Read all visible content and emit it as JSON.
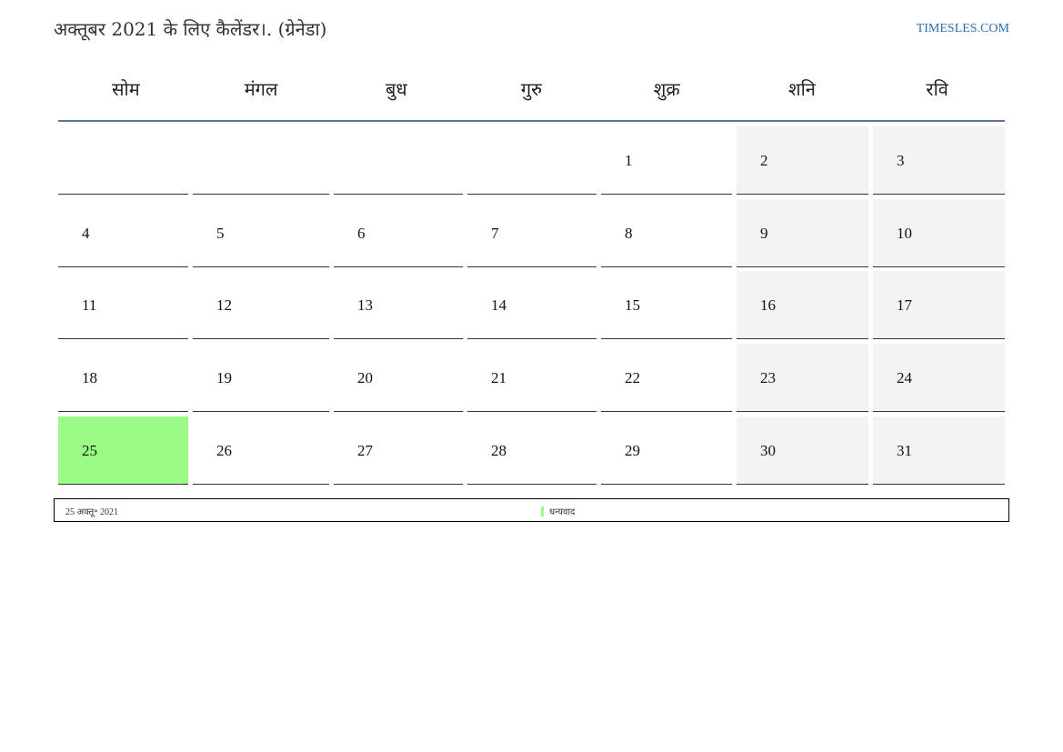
{
  "header": {
    "title": "अक्तूबर 2021 के लिए कैलेंडर।. (ग्रेनेडा)",
    "site": "TIMESLES.COM"
  },
  "weekdays": [
    "सोम",
    "मंगल",
    "बुध",
    "गुरु",
    "शुक्र",
    "शनि",
    "रवि"
  ],
  "weeks": [
    [
      "",
      "",
      "",
      "",
      "1",
      "2",
      "3"
    ],
    [
      "4",
      "5",
      "6",
      "7",
      "8",
      "9",
      "10"
    ],
    [
      "11",
      "12",
      "13",
      "14",
      "15",
      "16",
      "17"
    ],
    [
      "18",
      "19",
      "20",
      "21",
      "22",
      "23",
      "24"
    ],
    [
      "25",
      "26",
      "27",
      "28",
      "29",
      "30",
      "31"
    ]
  ],
  "highlight_day": "25",
  "colors": {
    "holiday": "#9bfb87",
    "weekend": "#f3f3f3",
    "weekday_rule": "#5a7896",
    "site_link": "#2a6fb0"
  },
  "footer": {
    "date": "25 अक्तू॰ 2021",
    "legend_label": "धन्यवाद"
  }
}
